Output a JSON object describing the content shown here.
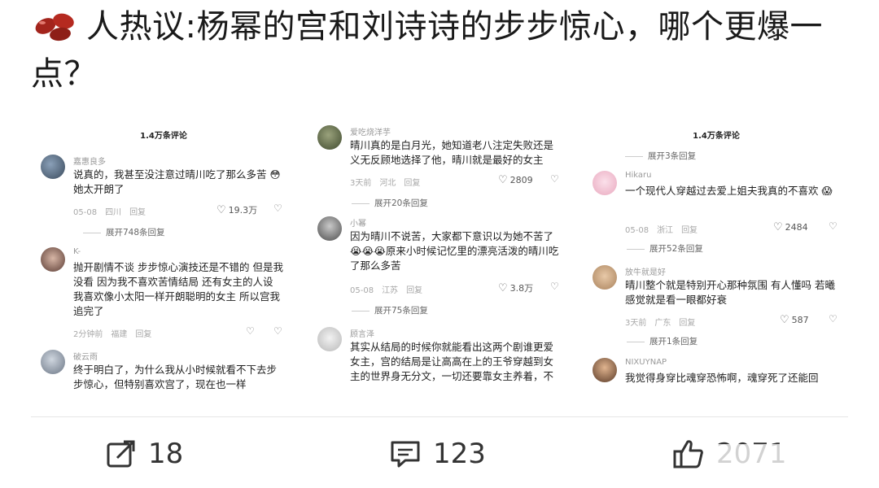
{
  "post": {
    "title": "人热议:杨幂的宫和刘诗诗的步步惊心，哪个更爆一点？",
    "emoji": "beans-emoji"
  },
  "panel1": {
    "header": "1.4万条评论",
    "comments": [
      {
        "name": "嘉惠良多",
        "text": "说真的，我甚至没注意过晴川吃了那么多苦 😳她太开朗了",
        "date": "05-08",
        "location": "四川",
        "reply": "回复",
        "likes": "19.3万",
        "expand": "展开748条回复"
      },
      {
        "name": "K-",
        "text": "抛开剧情不谈 步步惊心演技还是不错的 但是我没看 因为我不喜欢苦情结局 还有女主的人设 我喜欢像小太阳一样开朗聪明的女主 所以宫我追完了",
        "date": "2分钟前",
        "location": "福建",
        "reply": "回复",
        "likes": ""
      },
      {
        "name": "破云雨",
        "text": "终于明白了，为什么我从小时候就看不下去步步惊心，但特别喜欢宫了，现在也一样"
      }
    ]
  },
  "panel2": {
    "comments": [
      {
        "name": "爱吃烧洋芋",
        "text": "晴川真的是白月光，她知道老八注定失败还是义无反顾地选择了他，晴川就是最好的女主",
        "date": "3天前",
        "location": "河北",
        "reply": "回复",
        "likes": "2809",
        "expand": "展开20条回复"
      },
      {
        "name": "小幂",
        "text": "因为晴川不说苦，大家都下意识以为她不苦了😭😭😭原来小时候记忆里的漂亮活泼的晴川吃了那么多苦",
        "date": "05-08",
        "location": "江苏",
        "reply": "回复",
        "likes": "3.8万",
        "expand": "展开75条回复"
      },
      {
        "name": "顾言泽",
        "text": "其实从结局的时候你就能看出这两个剧谁更爱女主，宫的结局是让高高在上的王爷穿越到女主的世界身无分文，一切还要靠女主养着，不"
      }
    ]
  },
  "panel3": {
    "header": "1.4万条评论",
    "top_expand": "展开3条回复",
    "comments": [
      {
        "name": "Hikaru",
        "text": "一个现代人穿越过去爱上姐夫我真的不喜欢 😱",
        "date": "05-08",
        "location": "浙江",
        "reply": "回复",
        "likes": "2484",
        "expand": "展开52条回复"
      },
      {
        "name": "放牛就是好",
        "text": "晴川整个就是特别开心那种氛围 有人懂吗 若曦感觉就是看一眼都好衰",
        "date": "3天前",
        "location": "广东",
        "reply": "回复",
        "likes": "587",
        "expand": "展开1条回复"
      },
      {
        "name": "NIXUYNAP",
        "text": "我觉得身穿比魂穿恐怖啊，魂穿死了还能回"
      }
    ]
  },
  "actions": {
    "share_count": "18",
    "comment_count": "123",
    "like_count": "2071"
  },
  "colors": {
    "accent": "#333333",
    "meta": "#a8a8a8"
  }
}
